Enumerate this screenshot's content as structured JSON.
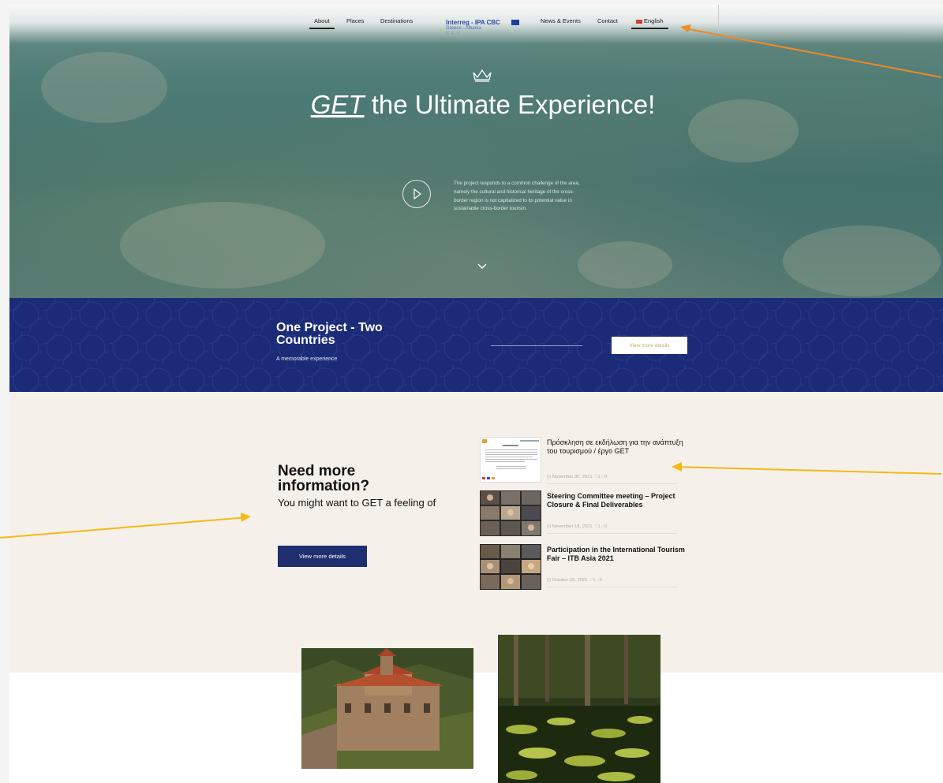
{
  "nav": {
    "items": [
      {
        "label": "About",
        "active": true
      },
      {
        "label": "Places"
      },
      {
        "label": "Destinations"
      },
      {
        "label": "News & Events"
      },
      {
        "label": "Contact"
      },
      {
        "label": "English",
        "active": true,
        "icon": "flag-icon"
      }
    ],
    "logo": {
      "main": "Interreg - IPA CBC",
      "sub": "Greece - Albania",
      "sub2": "G.E.T."
    }
  },
  "hero": {
    "title_em": "GET",
    "title_rest": " the Ultimate Experience!",
    "description": "The project responds to a common challenge of the area, namely the cultural and historical heritage of the cross-border region is not capitalized to its potential value in sustainable cross-border tourism.",
    "icons": [
      "crown-icon",
      "play-icon",
      "chevron-down-icon"
    ]
  },
  "banner": {
    "title": "One Project - Two Countries",
    "subtitle": "A memorable experience",
    "button": "View more details"
  },
  "info": {
    "title": "Need more information?",
    "subtitle": "You might want to GET a feeling of",
    "button": "View more details"
  },
  "news": [
    {
      "title": "Πρόσκληση σε εκδήλωση για την ανάπτυξη του τουρισμού / έργο GET",
      "date": "November 30, 2021",
      "likes": "1",
      "comments": "0"
    },
    {
      "title": "Steering Committee meeting – Project Closure & Final Deliverables",
      "date": "November 18, 2021",
      "likes": "1",
      "comments": "0"
    },
    {
      "title": "Participation in the International Tourism Fair – ITB Asia 2021",
      "date": "October 29, 2021",
      "likes": "1",
      "comments": "0"
    }
  ],
  "colors": {
    "navy": "#1b2b78",
    "button_navy": "#1f2e6e",
    "cream": "#f5f1ea",
    "gold": "#c9a86a",
    "annotation_orange": "#f08a24",
    "annotation_yellow": "#f5b915"
  }
}
